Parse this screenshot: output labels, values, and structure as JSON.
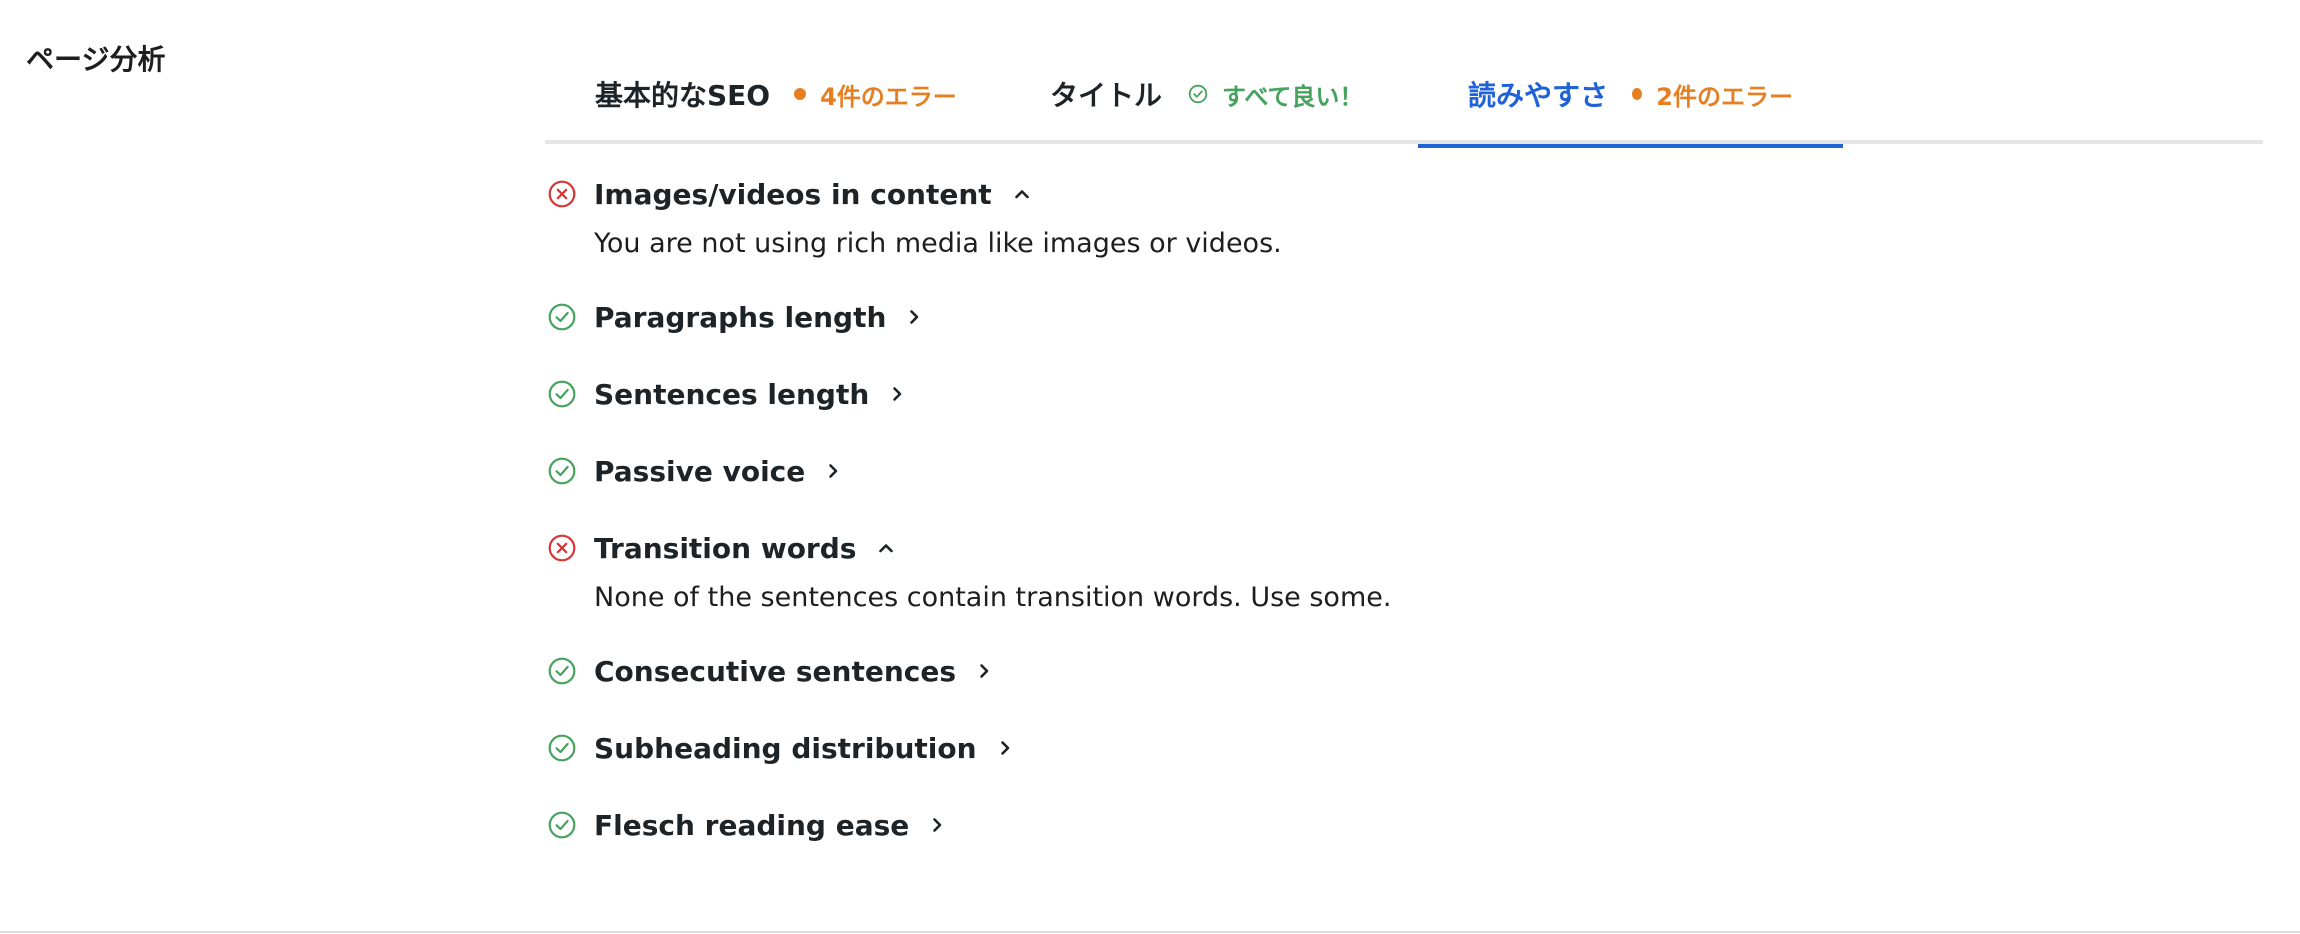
{
  "section_title": "ページ分析",
  "colors": {
    "accent_blue": "#2062d8",
    "warning_orange": "#e67e22",
    "success_green": "#46a35e",
    "error_red": "#d63638"
  },
  "tabs": [
    {
      "label": "基本的なSEO",
      "status": "4件のエラー",
      "status_type": "warning",
      "icon": "orange-dot-icon"
    },
    {
      "label": "タイトル",
      "status": "すべて良い！",
      "status_type": "success",
      "icon": "check-circle-icon"
    },
    {
      "label": "読みやすさ",
      "status": "2件のエラー",
      "status_type": "warning",
      "icon": "orange-dot-icon",
      "active": true
    }
  ],
  "checks": [
    {
      "title": "Images/videos in content",
      "state": "error",
      "expanded": true,
      "description": "You are not using rich media like images or videos."
    },
    {
      "title": "Paragraphs length",
      "state": "pass",
      "expanded": false
    },
    {
      "title": "Sentences length",
      "state": "pass",
      "expanded": false
    },
    {
      "title": "Passive voice",
      "state": "pass",
      "expanded": false
    },
    {
      "title": "Transition words",
      "state": "error",
      "expanded": true,
      "description": "None of the sentences contain transition words. Use some."
    },
    {
      "title": "Consecutive sentences",
      "state": "pass",
      "expanded": false
    },
    {
      "title": "Subheading distribution",
      "state": "pass",
      "expanded": false
    },
    {
      "title": "Flesch reading ease",
      "state": "pass",
      "expanded": false
    }
  ]
}
